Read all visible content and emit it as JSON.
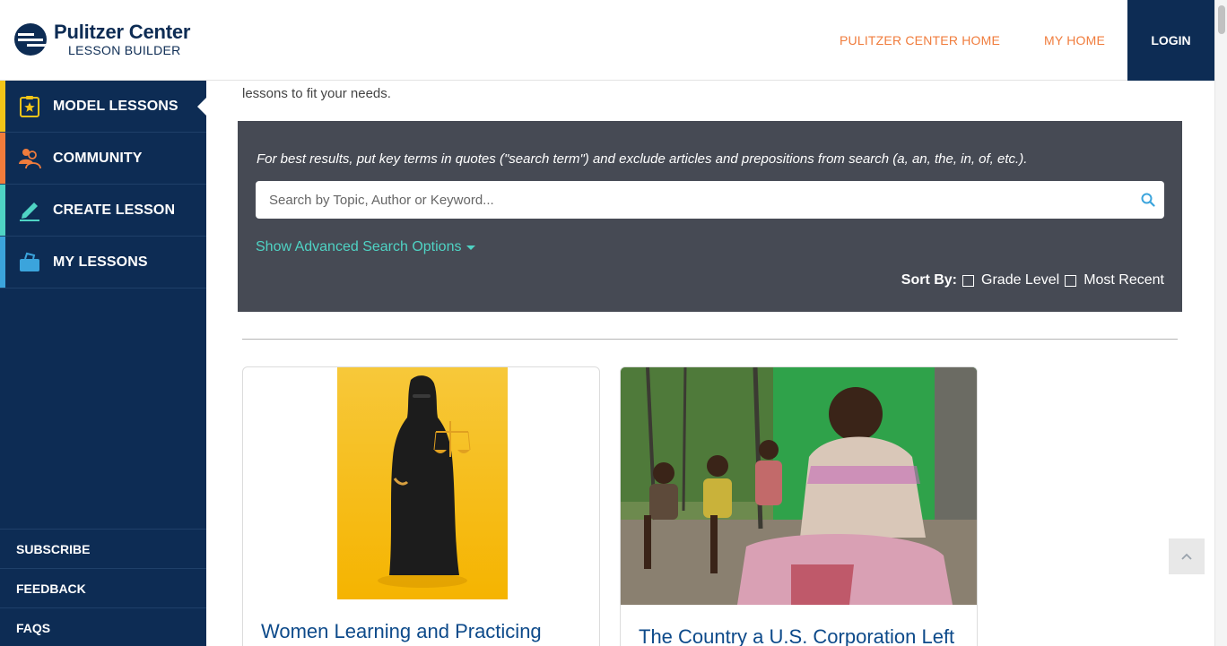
{
  "header": {
    "logo_title": "Pulitzer Center",
    "logo_subtitle": "LESSON BUILDER",
    "nav": {
      "pulitzer_home": "PULITZER CENTER HOME",
      "my_home": "MY HOME",
      "login": "LOGIN"
    }
  },
  "sidebar": {
    "items": [
      {
        "label": "MODEL LESSONS",
        "icon": "clipboard-star-icon",
        "accent": "#f2c418"
      },
      {
        "label": "COMMUNITY",
        "icon": "community-icon",
        "accent": "#f07c3c"
      },
      {
        "label": "CREATE LESSON",
        "icon": "pencil-icon",
        "accent": "#4fd3c4"
      },
      {
        "label": "MY LESSONS",
        "icon": "briefcase-icon",
        "accent": "#3ba4dc"
      }
    ],
    "footer": {
      "subscribe": "SUBSCRIBE",
      "feedback": "FEEDBACK",
      "faqs": "FAQS"
    }
  },
  "main": {
    "intro_text": "lessons to fit your needs.",
    "search": {
      "hint": "For best results, put key terms in quotes (\"search term\") and exclude articles and prepositions from search (a, an, the, in, of, etc.).",
      "placeholder": "Search by Topic, Author or Keyword...",
      "value": "",
      "advanced_label": "Show Advanced Search Options",
      "sort_label": "Sort By:",
      "sort_options": [
        "Grade Level",
        "Most Recent"
      ]
    },
    "cards": [
      {
        "title": "Women Learning and Practicing",
        "image": "woman-in-niqab-holding-scales-illustration"
      },
      {
        "title": "The Country a U.S. Corporation Left",
        "image": "woman-and-children-seated-photo"
      }
    ]
  },
  "colors": {
    "navy": "#0d2c54",
    "orange": "#f07c3c",
    "teal": "#4fd3c4",
    "panel": "#464a54",
    "card_title": "#0d4a8a"
  }
}
